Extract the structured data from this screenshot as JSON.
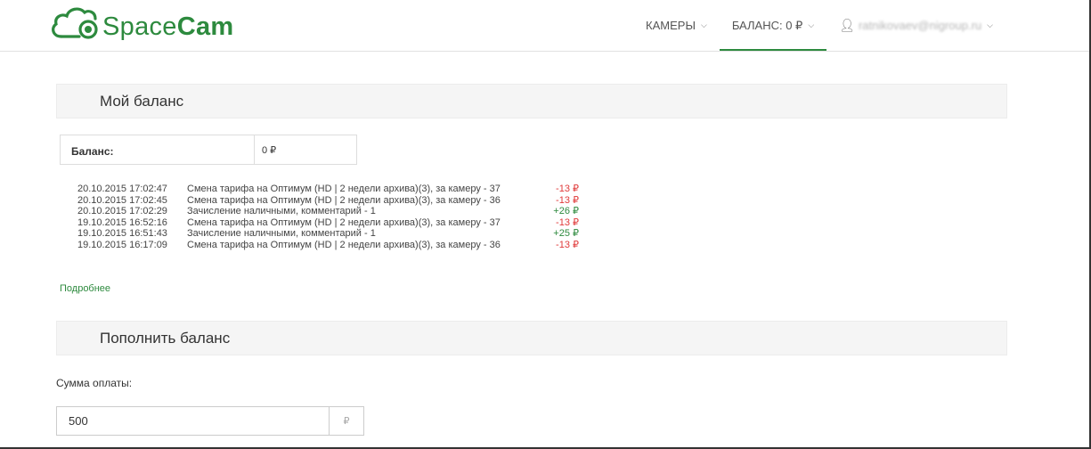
{
  "header": {
    "logo_text_light": "Space",
    "logo_text_bold": "Cam",
    "nav": {
      "cameras": "КАМЕРЫ",
      "balance": "БАЛАНС: 0 ₽",
      "user_email": "ratnikovaev@nigroup.ru"
    },
    "icons": {
      "caret": "chevron-down-icon",
      "user": "user-icon"
    }
  },
  "my_balance": {
    "title": "Мой баланс",
    "balance_label": "Баланс:",
    "balance_value": "0 ₽",
    "transactions": [
      {
        "date": "20.10.2015 17:02:47",
        "desc": "Смена тарифа на Оптимум (HD | 2 недели архива)(3), за камеру - 37",
        "amount": "-13 ₽",
        "type": "neg"
      },
      {
        "date": "20.10.2015 17:02:45",
        "desc": "Смена тарифа на Оптимум (HD | 2 недели архива)(3), за камеру - 36",
        "amount": "-13 ₽",
        "type": "neg"
      },
      {
        "date": "20.10.2015 17:02:29",
        "desc": "Зачисление наличными, комментарий - 1",
        "amount": "+26 ₽",
        "type": "pos"
      },
      {
        "date": "19.10.2015 16:52:16",
        "desc": "Смена тарифа на Оптимум (HD | 2 недели архива)(3), за камеру - 37",
        "amount": "-13 ₽",
        "type": "neg"
      },
      {
        "date": "19.10.2015 16:51:43",
        "desc": "Зачисление наличными, комментарий - 1",
        "amount": "+25 ₽",
        "type": "pos"
      },
      {
        "date": "19.10.2015 16:17:09",
        "desc": "Смена тарифа на Оптимум (HD | 2 недели архива)(3), за камеру - 36",
        "amount": "-13 ₽",
        "type": "neg"
      }
    ],
    "more_link": "Подробнее"
  },
  "top_up": {
    "title": "Пополнить баланс",
    "amount_label": "Сумма оплаты:",
    "amount_value": "500",
    "currency_symbol": "₽"
  },
  "colors": {
    "brand": "#2d8a3e",
    "negative": "#e03a3a",
    "positive": "#2d8a3e"
  }
}
